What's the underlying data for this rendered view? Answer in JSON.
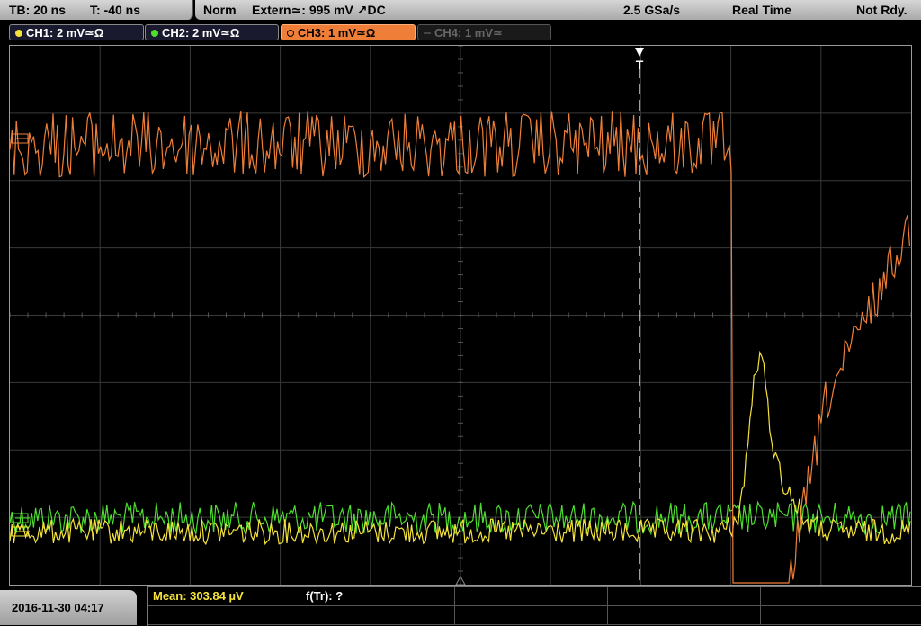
{
  "topbar": {
    "timebase": "TB: 20 ns",
    "trigger_time": "T: -40 ns",
    "trigger_mode": "Norm",
    "trigger_source": "Extern≃: 995 mV ↗DC",
    "sample_rate": "2.5 GSa/s",
    "acq_mode": "Real Time",
    "status": "Not Rdy."
  },
  "channels": [
    {
      "label": "CH1: 2 mV≃Ω",
      "color": "#f5e33b",
      "state": "on"
    },
    {
      "label": "CH2: 2 mV≃Ω",
      "color": "#4ede2f",
      "state": "on"
    },
    {
      "label": "CH3: 1 mV≃Ω",
      "color": "#ef7f38",
      "state": "selected"
    },
    {
      "label": "CH4: 1 mV≃",
      "color": "#666666",
      "state": "off"
    }
  ],
  "screen": {
    "trigger_marker": "T",
    "colors": {
      "grid": "#3a3a3a",
      "ch1": "#f5e33b",
      "ch2": "#4ede2f",
      "ch3": "#ef7f38",
      "trigger_line": "#ffffff"
    }
  },
  "footer": {
    "datetime": "2016-11-30 04:17",
    "measurements": [
      {
        "label": "Mean: 303.84 µV",
        "color": "#f5e33b"
      },
      {
        "label": "f(Tr): ?",
        "color": "#ffffff"
      }
    ]
  }
}
